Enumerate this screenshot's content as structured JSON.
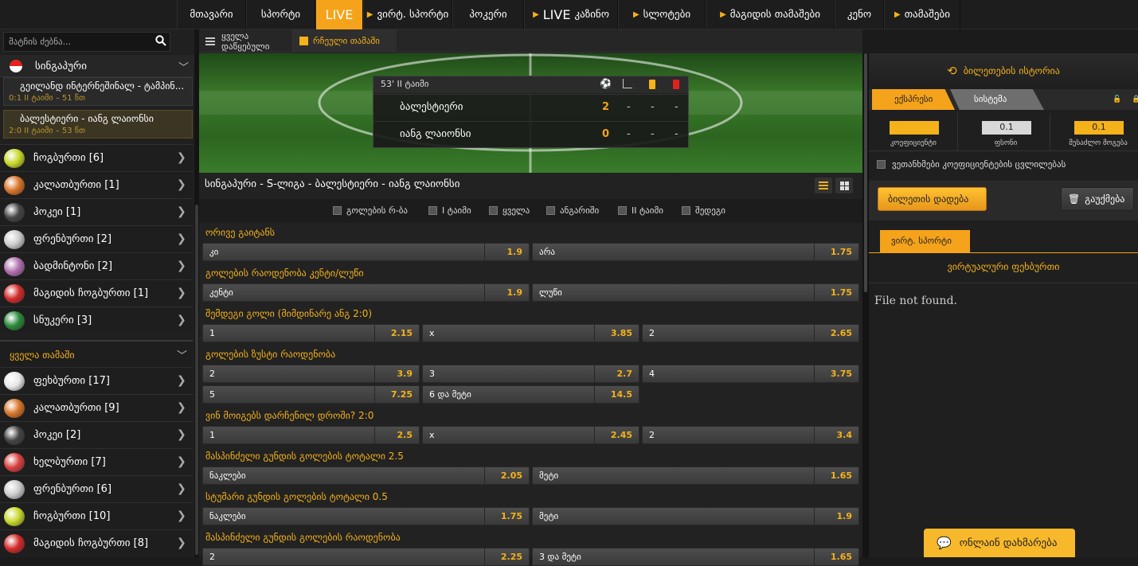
{
  "nav": {
    "items": [
      {
        "label": "მთავარი",
        "arrow": false
      },
      {
        "label": "სპორტი",
        "arrow": false
      },
      {
        "label": "LIVE",
        "arrow": false,
        "active": true
      },
      {
        "label": "ვირტ. სპორტი",
        "arrow": true
      },
      {
        "label": "პოკერი",
        "arrow": false
      },
      {
        "label": "LIVE",
        "suffix": "კაზინო",
        "arrow": true
      },
      {
        "label": "სლოტები",
        "arrow": true
      },
      {
        "label": "მაგიდის თამაშები",
        "arrow": true
      },
      {
        "label": "კენო",
        "arrow": false
      },
      {
        "label": "თამაშები",
        "arrow": true
      }
    ]
  },
  "sidebar": {
    "search_placeholder": "მატჩის ძებნა...",
    "region": "სინგაპური",
    "matches": [
      {
        "title": "გეილანდ ინტერნეშინალ - ტამპინ...",
        "status": "0:1 II ტაიმი – 51 წთ",
        "active": false
      },
      {
        "title": "ბალესტიერი - იანგ ლაიონსი",
        "status": "2:0 II ტაიმი – 53 წთ",
        "active": true
      }
    ],
    "live_sports": [
      {
        "label": "ჩოგბურთი [6]",
        "icon": "tennis-ball-icon",
        "color": "#c8d82a"
      },
      {
        "label": "კალათბურთი [1]",
        "icon": "basketball-icon",
        "color": "#d9742a"
      },
      {
        "label": "ჰოკეი [1]",
        "icon": "hockey-puck-icon",
        "color": "#444444"
      },
      {
        "label": "ფრენბურთი [2]",
        "icon": "volleyball-icon",
        "color": "#cccccc"
      },
      {
        "label": "ბადმინტონი [2]",
        "icon": "shuttlecock-icon",
        "color": "#b070b0"
      },
      {
        "label": "მაგიდის ჩოგბურთი [1]",
        "icon": "table-tennis-icon",
        "color": "#d22a2a"
      },
      {
        "label": "სნუკერი [3]",
        "icon": "snooker-icon",
        "color": "#2a8a3a"
      }
    ],
    "all_games_label": "ყველა თამაში",
    "all_sports": [
      {
        "label": "ფეხბურთი [17]",
        "icon": "soccer-ball-icon",
        "color": "#e8e8e8"
      },
      {
        "label": "კალათბურთი [9]",
        "icon": "basketball-icon",
        "color": "#d9742a"
      },
      {
        "label": "ჰოკეი [2]",
        "icon": "hockey-puck-icon",
        "color": "#444444"
      },
      {
        "label": "ხელბურთი [7]",
        "icon": "handball-icon",
        "color": "#d84040"
      },
      {
        "label": "ფრენბურთი [6]",
        "icon": "volleyball-icon",
        "color": "#cccccc"
      },
      {
        "label": "ჩოგბურთი [10]",
        "icon": "tennis-ball-icon",
        "color": "#c8d82a"
      },
      {
        "label": "მაგიდის ჩოგბურთი [8]",
        "icon": "table-tennis-icon",
        "color": "#d22a2a"
      }
    ]
  },
  "center": {
    "tab_all": "ყველა დაწყებული",
    "tab_selected": "რჩეული თამაში",
    "scoreboard": {
      "period": "53' II ტაიმი",
      "teams": [
        {
          "name": "ბალესტიერი",
          "goals": "2",
          "cols": [
            "-",
            "-",
            "-"
          ]
        },
        {
          "name": "იანგ ლაიონსი",
          "goals": "0",
          "cols": [
            "-",
            "-",
            "-"
          ]
        }
      ]
    },
    "event_title": "სინგაპური - S-ლიგა - ბალესტიერი - იანგ ლაიონსი",
    "filters": [
      "გოლების რ-ბა",
      "I ტაიმი",
      "ყველა",
      "ანგარიში",
      "II ტაიმი",
      "შედეგი"
    ],
    "markets": [
      {
        "title": "ორივე გაიტანს",
        "rows": [
          [
            {
              "n": "კი",
              "v": "1.9"
            },
            {
              "n": "არა",
              "v": "1.75"
            }
          ]
        ]
      },
      {
        "title": "გოლების რაოდენობა კენტი/ლუწი",
        "rows": [
          [
            {
              "n": "კენტი",
              "v": "1.9"
            },
            {
              "n": "ლუწი",
              "v": "1.75"
            }
          ]
        ]
      },
      {
        "title": "შემდეგი გოლი (მიმდინარე ანგ 2:0)",
        "rows": [
          [
            {
              "n": "1",
              "v": "2.15"
            },
            {
              "n": "x",
              "v": "3.85"
            },
            {
              "n": "2",
              "v": "2.65"
            }
          ]
        ]
      },
      {
        "title": "გოლების ზუსტი რაოდენობა",
        "rows": [
          [
            {
              "n": "2",
              "v": "3.9"
            },
            {
              "n": "3",
              "v": "2.7"
            },
            {
              "n": "4",
              "v": "3.75"
            }
          ],
          [
            {
              "n": "5",
              "v": "7.25"
            },
            {
              "n": "6 და მეტი",
              "v": "14.5"
            }
          ]
        ]
      },
      {
        "title": "ვინ მოიგებს დარჩენილ დროში? 2:0",
        "rows": [
          [
            {
              "n": "1",
              "v": "2.5"
            },
            {
              "n": "x",
              "v": "2.45"
            },
            {
              "n": "2",
              "v": "3.4"
            }
          ]
        ]
      },
      {
        "title": "მასპინძელი გუნდის გოლების ტოტალი 2.5",
        "rows": [
          [
            {
              "n": "ნაკლები",
              "v": "2.05"
            },
            {
              "n": "მეტი",
              "v": "1.65"
            }
          ]
        ]
      },
      {
        "title": "სტუმარი გუნდის გოლების ტოტალი 0.5",
        "rows": [
          [
            {
              "n": "ნაკლები",
              "v": "1.75"
            },
            {
              "n": "მეტი",
              "v": "1.9"
            }
          ]
        ]
      },
      {
        "title": "მასპინძელი გუნდის გოლების რაოდენობა",
        "rows": [
          [
            {
              "n": "2",
              "v": "2.25"
            },
            {
              "n": "3 და მეტი",
              "v": "1.65"
            }
          ]
        ]
      }
    ]
  },
  "betslip": {
    "history": "ბილეთების ისტორია",
    "tab_express": "ექსპრესი",
    "tab_system": "სისტემა",
    "coef_value": "",
    "coef_label": "კოეფიციენტი",
    "stake_value": "0.1",
    "stake_label": "ფსონი",
    "win_value": "0.1",
    "win_label": "შესაძლო მოგება",
    "agree_label": "ვეთანხმები კოეფიციენტების ცვლილებას",
    "place_label": "ბილეთის დადება",
    "cancel_label": "გაუქმება",
    "virtual_tab": "ვირტ. სპორტი",
    "virtual_title": "ვირტუალური ფეხბურთი",
    "not_found": "File not found.",
    "help_label": "ონლაინ დახმარება"
  },
  "colors": {
    "accent": "#f5a31a",
    "odds": "#f5b21a",
    "bg": "#1b1b1b"
  }
}
